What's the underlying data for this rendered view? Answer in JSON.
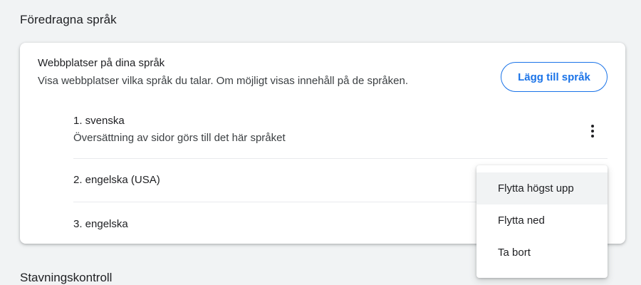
{
  "section": {
    "title": "Föredragna språk"
  },
  "card": {
    "title": "Webbplatser på dina språk",
    "description": "Visa webbplatser vilka språk du talar. Om möjligt visas innehåll på de språken.",
    "add_button": "Lägg till språk"
  },
  "languages": [
    {
      "label": "1. svenska",
      "subtitle": "Översättning av sidor görs till det här språket"
    },
    {
      "label": "2. engelska (USA)"
    },
    {
      "label": "3. engelska"
    }
  ],
  "more_menu": {
    "icon": "more-vert-icon",
    "items": [
      {
        "label": "Flytta högst upp",
        "highlighted": true
      },
      {
        "label": "Flytta ned"
      },
      {
        "label": "Ta bort"
      }
    ]
  },
  "next_section": {
    "title": "Stavningskontroll"
  },
  "colors": {
    "accent": "#1a73e8",
    "background": "#f1f3f4",
    "card": "#ffffff"
  }
}
